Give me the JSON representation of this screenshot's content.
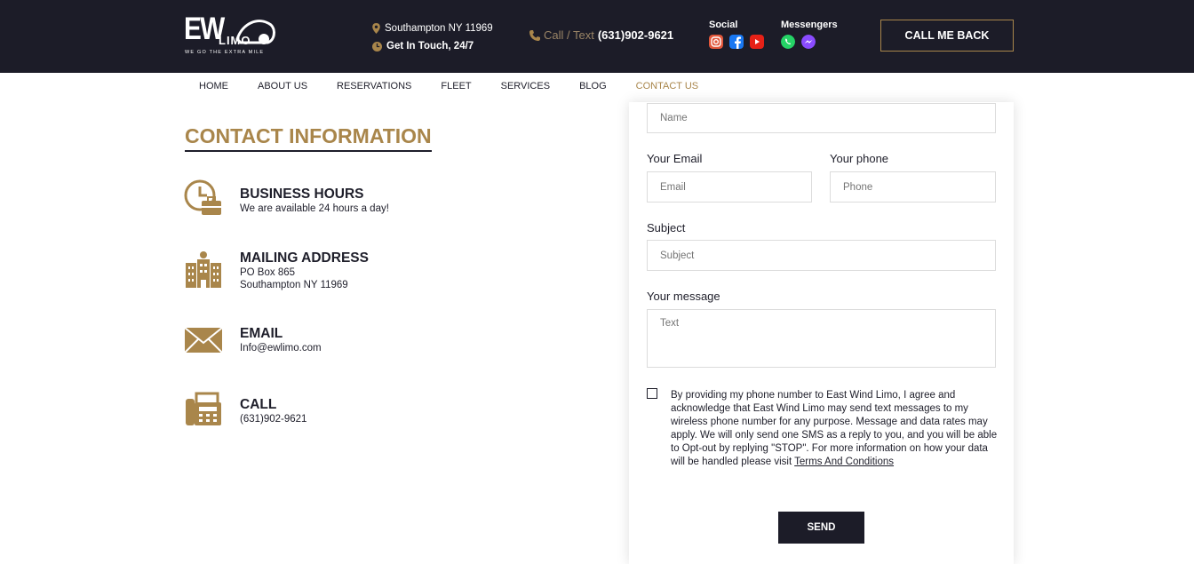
{
  "header": {
    "logo_main": "EW",
    "logo_sub": "LIMO",
    "logo_tagline": "WE GO THE EXTRA MILE",
    "address": "Southampton NY 11969",
    "availability": "Get In Touch, 24/7",
    "call_label": "Call / Text",
    "call_number": "(631)902-9621",
    "social_label": "Social",
    "messengers_label": "Messengers",
    "callback_button": "CALL ME BACK"
  },
  "nav": {
    "items": [
      "HOME",
      "ABOUT US",
      "RESERVATIONS",
      "FLEET",
      "SERVICES",
      "BLOG",
      "CONTACT US"
    ]
  },
  "contact": {
    "title": "CONTACT INFORMATION",
    "hours_title": "BUSINESS HOURS",
    "hours_text": "We are available 24 hours a day!",
    "mail_title": "MAILING ADDRESS",
    "mail_line1": "PO Box 865",
    "mail_line2": "Southampton NY 11969",
    "email_title": "EMAIL",
    "email_text": "Info@ewlimo.com",
    "call_title": "CALL",
    "call_text": "(631)902-9621"
  },
  "form": {
    "name_placeholder": "Name",
    "email_label": "Your Email",
    "email_placeholder": "Email",
    "phone_label": "Your phone",
    "phone_placeholder": "Phone",
    "subject_label": "Subject",
    "subject_placeholder": "Subject",
    "message_label": "Your message",
    "message_placeholder": "Text",
    "consent_text": "By providing my phone number to East Wind Limo, I agree and acknowledge that East Wind Limo may send text messages to my wireless phone number for any purpose. Message and data rates may apply. We will only send one SMS as a reply to you, and you will be able to Opt-out by replying \"STOP\". For more information on how your data will be handled please visit ",
    "consent_link": "Terms And Conditions",
    "send_button": "SEND"
  },
  "colors": {
    "accent": "#a9864b",
    "dark": "#1c1c28"
  }
}
